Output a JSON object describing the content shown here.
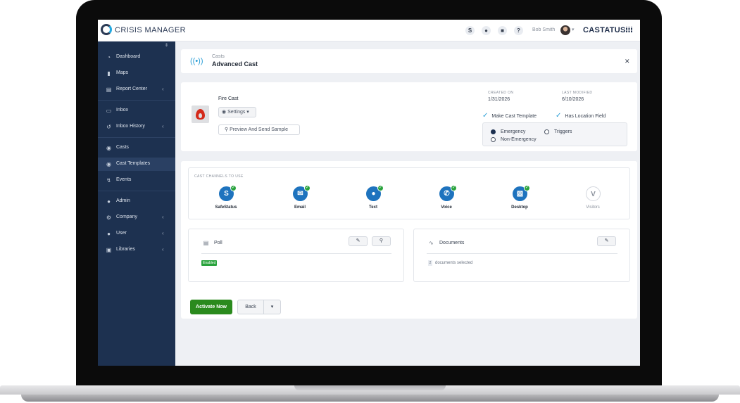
{
  "app": {
    "title": "CRISIS MANAGER",
    "brand": "CASTATUS",
    "user_name": "Bob Smith"
  },
  "topbar_icons": [
    "status-icon",
    "bell-icon",
    "contacts-icon",
    "help-icon"
  ],
  "sidebar": {
    "items": [
      {
        "label": "Dashboard",
        "icon": "dashboard-icon",
        "has_submenu": false
      },
      {
        "label": "Maps",
        "icon": "map-icon",
        "has_submenu": false
      },
      {
        "label": "Report Center",
        "icon": "chart-icon",
        "has_submenu": true
      },
      {
        "label": "Inbox",
        "icon": "inbox-icon",
        "has_submenu": false
      },
      {
        "label": "Inbox History",
        "icon": "history-icon",
        "has_submenu": true
      },
      {
        "label": "Casts",
        "icon": "broadcast-icon",
        "has_submenu": false
      },
      {
        "label": "Cast Templates",
        "icon": "broadcast-icon",
        "has_submenu": false,
        "active": true
      },
      {
        "label": "Events",
        "icon": "bolt-icon",
        "has_submenu": false
      },
      {
        "label": "Admin",
        "icon": "user-gear-icon",
        "has_submenu": false
      },
      {
        "label": "Company",
        "icon": "gears-icon",
        "has_submenu": true
      },
      {
        "label": "User",
        "icon": "user-icon",
        "has_submenu": true
      },
      {
        "label": "Libraries",
        "icon": "briefcase-icon",
        "has_submenu": true
      }
    ]
  },
  "header": {
    "breadcrumb": "Casts",
    "title": "Advanced Cast"
  },
  "cast": {
    "name": "Fire Cast",
    "settings_label": "Settings",
    "preview_label": "Preview And Send Sample",
    "created_label": "CREATED ON",
    "created_value": "1/31/2026",
    "modified_label": "LAST MODIFIED",
    "modified_value": "6/10/2026",
    "make_template_label": "Make Cast Template",
    "location_field_label": "Has Location Field",
    "radio_options": [
      {
        "label": "Emergency",
        "selected": true
      },
      {
        "label": "Triggers",
        "selected": false
      },
      {
        "label": "Non-Emergency",
        "selected": false
      }
    ]
  },
  "channels": {
    "title": "CAST CHANNELS TO USE",
    "items": [
      {
        "label": "SafeStatus",
        "icon": "safestatus-icon",
        "enabled": true
      },
      {
        "label": "Email",
        "icon": "envelope-icon",
        "enabled": true
      },
      {
        "label": "Text",
        "icon": "chat-icon",
        "enabled": true
      },
      {
        "label": "Voice",
        "icon": "phone-icon",
        "enabled": true
      },
      {
        "label": "Desktop",
        "icon": "desktop-icon",
        "enabled": true
      },
      {
        "label": "Visitors",
        "icon": "visitors-icon",
        "enabled": false
      }
    ]
  },
  "poll": {
    "title": "Poll",
    "status": "Enabled"
  },
  "documents": {
    "title": "Documents",
    "count": "2",
    "count_text": "documents selected"
  },
  "actions": {
    "activate_label": "Activate Now",
    "back_label": "Back"
  },
  "colors": {
    "sidebar": "#1d3150",
    "accent": "#1e73be",
    "success": "#2aa33d",
    "activate": "#2a8a1d"
  }
}
